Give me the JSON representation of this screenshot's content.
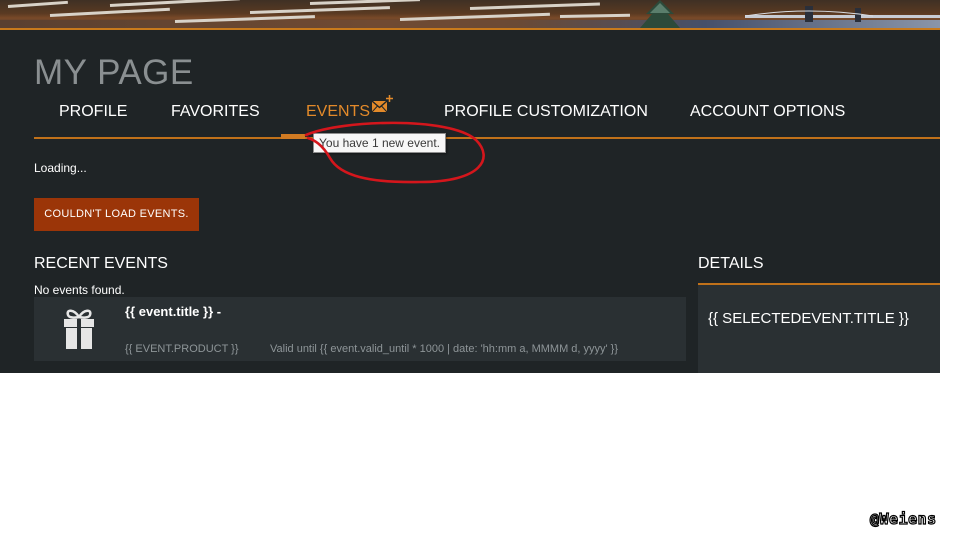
{
  "page": {
    "title": "MY PAGE"
  },
  "nav": {
    "items": [
      {
        "label": "PROFILE"
      },
      {
        "label": "FAVORITES"
      },
      {
        "label": "EVENTS",
        "active": true
      },
      {
        "label": "PROFILE CUSTOMIZATION"
      },
      {
        "label": "ACCOUNT OPTIONS"
      }
    ],
    "events_icon": "mail-plus-icon"
  },
  "tooltip": {
    "text": "You have 1 new event."
  },
  "status": {
    "loading": "Loading...",
    "error_button": "COULDN'T LOAD EVENTS."
  },
  "recent_events": {
    "title": "RECENT EVENTS",
    "empty_text": "No events found.",
    "card": {
      "icon": "gift-icon",
      "title": "{{ event.title }} -",
      "product": "{{ EVENT.PRODUCT }}",
      "valid": "Valid until {{ event.valid_until * 1000 | date: 'hh:mm a, MMMM d, yyyy' }}"
    }
  },
  "details": {
    "title": "DETAILS",
    "value": "{{ SELECTEDEVENT.TITLE }}"
  },
  "watermark": {
    "text": "@Weiens"
  },
  "colors": {
    "background": "#1f2426",
    "card": "#2a3033",
    "accent_orange": "#c0711a",
    "active_tab": "#e38a2a",
    "error_button": "#9b3508",
    "annotation_red": "#d4161c"
  }
}
